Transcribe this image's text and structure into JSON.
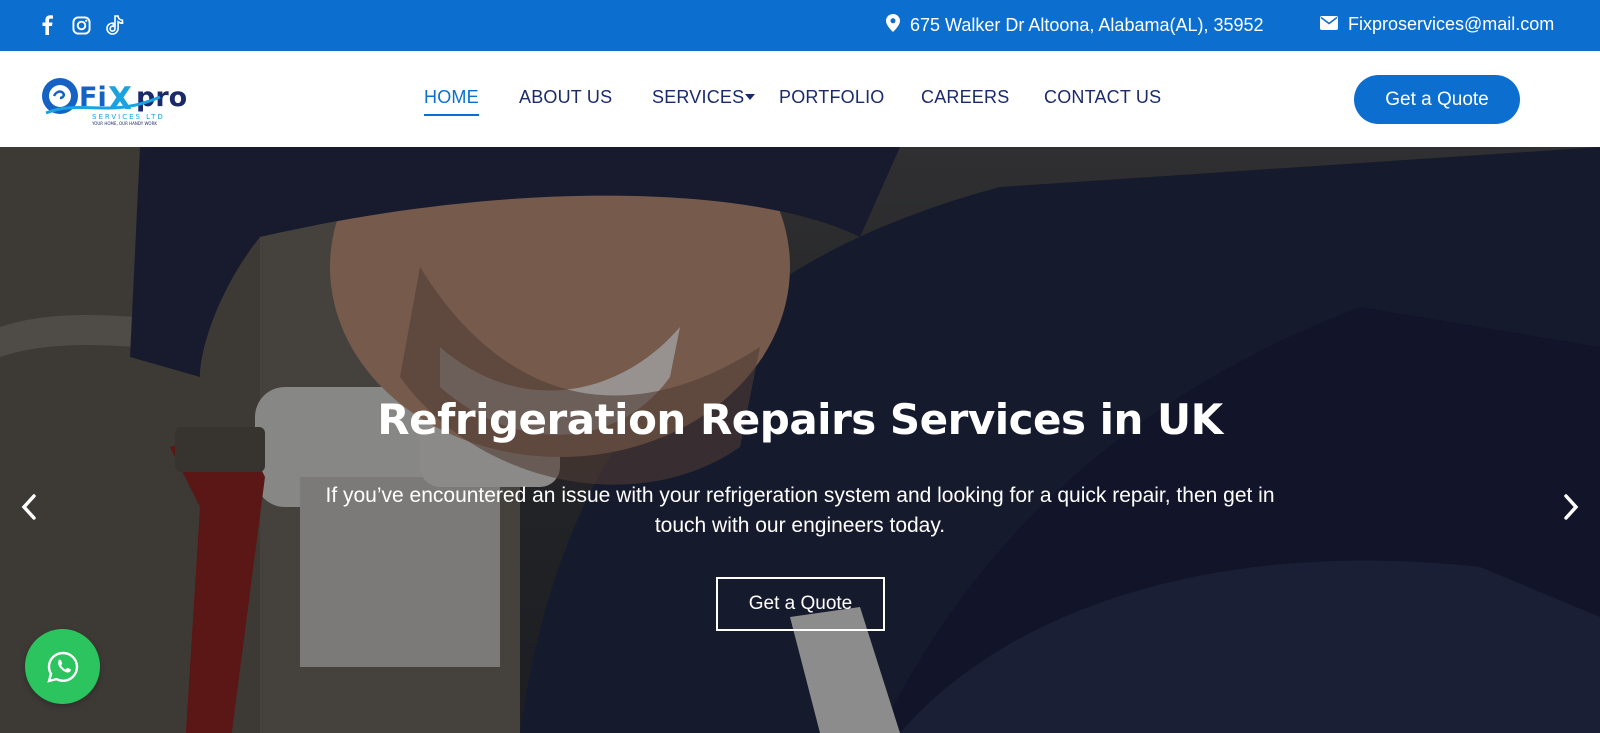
{
  "topbar": {
    "social": [
      "facebook-icon",
      "instagram-icon",
      "tiktok-icon"
    ],
    "address": "675 Walker Dr Altoona, Alabama(AL), 35952",
    "email": "Fixproservices@mail.com"
  },
  "logo": {
    "brand_a": "Fi",
    "brand_x": "X",
    "brand_b": "pro",
    "sub": "SERVICES LTD",
    "tagline": "YOUR HOME, OUR HANDY WORK"
  },
  "nav": {
    "items": [
      {
        "label": "HOME",
        "active": true
      },
      {
        "label": "ABOUT US",
        "active": false
      },
      {
        "label": "SERVICES",
        "active": false
      },
      {
        "label": "PORTFOLIO",
        "active": false
      },
      {
        "label": "CAREERS",
        "active": false
      },
      {
        "label": "CONTACT US",
        "active": false
      }
    ],
    "cta": "Get a Quote"
  },
  "hero": {
    "title": "Refrigeration Repairs Services in UK",
    "text": "If you’ve encountered an issue with your refrigeration system and looking for a quick repair, then get in touch with our engineers today.",
    "cta": "Get a Quote"
  },
  "colors": {
    "brand_blue": "#0c6fcf",
    "nav_text": "#1b2a6b",
    "whatsapp": "#2cc45e"
  }
}
